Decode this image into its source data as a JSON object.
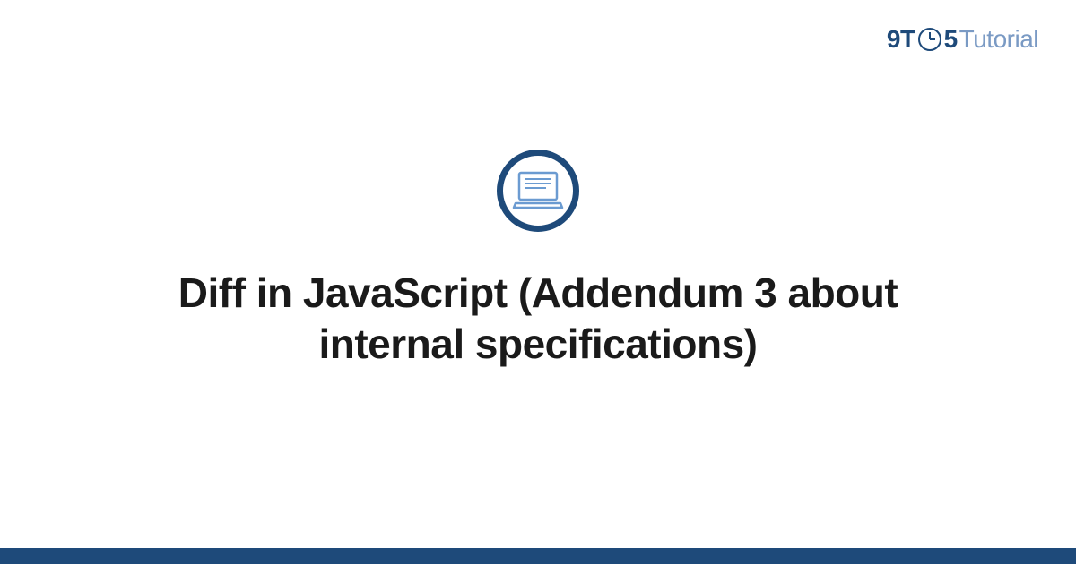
{
  "header": {
    "logo_prefix": "9T",
    "logo_suffix": "5",
    "logo_word": "Tutorial"
  },
  "main": {
    "title": "Diff in JavaScript (Addendum 3 about internal specifications)"
  },
  "colors": {
    "brand_dark": "#1e4a7a",
    "brand_light": "#7a9ac4",
    "laptop_stroke": "#6b9bd1"
  }
}
